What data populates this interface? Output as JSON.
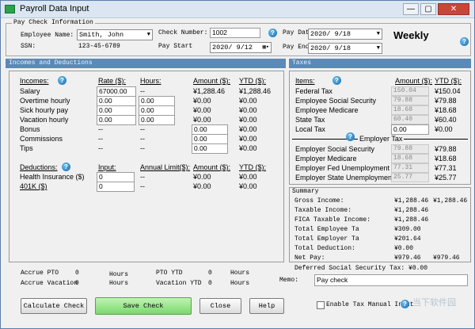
{
  "window": {
    "title": "Payroll Data Input",
    "min": "—",
    "max": "▢",
    "close": "✕"
  },
  "pay_info": {
    "group_title": "Pay Check Information",
    "employee_name_label": "Employee Name:",
    "employee_name": "Smith, John",
    "ssn_label": "SSN:",
    "ssn": "123-45-6789",
    "check_number_label": "Check Number:",
    "check_number": "1002",
    "pay_start_label": "Pay Start",
    "pay_start": "2020/ 9/12",
    "pay_date_label": "Pay Date:",
    "pay_date": "2020/ 9/18",
    "pay_end_label": "Pay End:",
    "pay_end": "2020/ 9/18",
    "frequency": "Weekly"
  },
  "incomes": {
    "section_title": "Incomes and Deductions",
    "headers": {
      "incomes": "Incomes:",
      "rate": "Rate ($):",
      "hours": "Hours:",
      "amount": "Amount ($):",
      "ytd": "YTD ($):"
    },
    "rows": [
      {
        "label": "Salary",
        "rate": "67000.00",
        "hours": "--",
        "amount": "¥1,288.46",
        "ytd": "¥1,288.46"
      },
      {
        "label": "Overtime hourly",
        "rate": "0.00",
        "hours": "0.00",
        "amount": "¥0.00",
        "ytd": "¥0.00"
      },
      {
        "label": "Sick hourly pay",
        "rate": "0.00",
        "hours": "0.00",
        "amount": "¥0.00",
        "ytd": "¥0.00"
      },
      {
        "label": "Vacation hourly",
        "rate": "0.00",
        "hours": "0.00",
        "amount": "¥0.00",
        "ytd": "¥0.00"
      },
      {
        "label": "Bonus",
        "rate": "--",
        "hours": "--",
        "amount": "0.00",
        "ytd": "¥0.00"
      },
      {
        "label": "Commissions",
        "rate": "--",
        "hours": "--",
        "amount": "0.00",
        "ytd": "¥0.00"
      },
      {
        "label": "Tips",
        "rate": "--",
        "hours": "--",
        "amount": "0.00",
        "ytd": "¥0.00"
      }
    ],
    "ded_headers": {
      "deductions": "Deductions:",
      "input": "Input:",
      "limit": "Annual Limit($):",
      "amount": "Amount ($):",
      "ytd": "YTD ($):"
    },
    "ded_rows": [
      {
        "label": "Health Insurance  ($)",
        "input": "0",
        "limit": "--",
        "amount": "¥0.00",
        "ytd": "¥0.00"
      },
      {
        "label": "401K  ($)",
        "input": "0",
        "limit": "--",
        "amount": "¥0.00",
        "ytd": "¥0.00"
      }
    ]
  },
  "taxes": {
    "section_title": "Taxes",
    "headers": {
      "items": "Items:",
      "amount": "Amount ($):",
      "ytd": "YTD ($):"
    },
    "rows": [
      {
        "label": "Federal Tax",
        "amount": "150.04",
        "ytd": "¥150.04"
      },
      {
        "label": "Employee Social Security",
        "amount": "79.88",
        "ytd": "¥79.88"
      },
      {
        "label": "Employee Medicare",
        "amount": "18.68",
        "ytd": "¥18.68"
      },
      {
        "label": "State Tax",
        "amount": "60.40",
        "ytd": "¥60.40"
      },
      {
        "label": "Local Tax",
        "amount": "0.00",
        "ytd": "¥0.00"
      }
    ],
    "employer_title": "Employer Tax",
    "employer_rows": [
      {
        "label": "Employer Social Security",
        "amount": "79.88",
        "ytd": "¥79.88"
      },
      {
        "label": "Employer Medicare",
        "amount": "18.68",
        "ytd": "¥18.68"
      },
      {
        "label": "Employer Fed Unemployment",
        "amount": "77.31",
        "ytd": "¥77.31"
      },
      {
        "label": "Employer State Unemployment",
        "amount": "25.77",
        "ytd": "¥25.77"
      }
    ]
  },
  "summary": {
    "title": "Summary",
    "rows": [
      {
        "label": "Gross Income:",
        "value": "¥1,288.46",
        "ytd": "¥1,288.46"
      },
      {
        "label": "Taxable Income:",
        "value": "¥1,288.46",
        "ytd": ""
      },
      {
        "label": "FICA Taxable Income:",
        "value": "¥1,288.46",
        "ytd": ""
      },
      {
        "label": "Total  Employee Ta",
        "value": "¥309.00",
        "ytd": ""
      },
      {
        "label": "Total  Employer Ta",
        "value": "¥201.64",
        "ytd": ""
      },
      {
        "label": "Total Deduction:",
        "value": "¥0.00",
        "ytd": ""
      },
      {
        "label": "Net Pay:",
        "value": "¥979.46",
        "ytd": "¥979.46"
      }
    ],
    "deferred": "Deferred Social Security Tax: ¥0.00"
  },
  "pto": {
    "accrue_pto_label": "Accrue PTO",
    "accrue_pto": "0",
    "accrue_vac_label": "Accrue Vacation",
    "accrue_vac": "0",
    "hours_label": "Hours",
    "pto_ytd_label": "PTO YTD",
    "pto_ytd": "0",
    "vac_ytd_label": "Vacation YTD",
    "vac_ytd": "0"
  },
  "memo": {
    "label": "Memo:",
    "value": "Pay check"
  },
  "buttons": {
    "calculate": "Calculate Check",
    "save": "Save Check",
    "close": "Close",
    "help": "Help"
  },
  "enable_tax_label": "Enable Tax Manual Input",
  "watermark": "当下软件园",
  "help_glyph": "?",
  "colors": {
    "section_bar": "#5b8ab8",
    "save_button": "#7ad86d"
  }
}
